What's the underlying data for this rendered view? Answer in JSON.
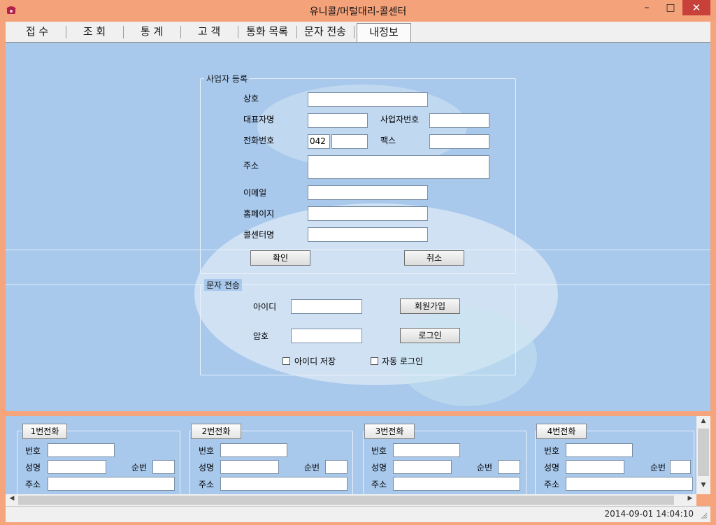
{
  "window": {
    "title": "유니콜/머털대리-콜센터",
    "minimize": "–",
    "maximize": "□",
    "close": "✕"
  },
  "tabs": [
    {
      "label": "접 수"
    },
    {
      "label": "조 회"
    },
    {
      "label": "통 계"
    },
    {
      "label": "고 객"
    },
    {
      "label": "통화 목록"
    },
    {
      "label": "문자 전송"
    },
    {
      "label": "내정보"
    }
  ],
  "business_reg": {
    "legend": "사업자 등록",
    "company_label": "상호",
    "company_value": "",
    "rep_label": "대표자명",
    "rep_value": "",
    "bizno_label": "사업자번호",
    "bizno_value": "",
    "phone_label": "전화번호",
    "phone_area": "042",
    "phone_value": "",
    "fax_label": "팩스",
    "fax_value": "",
    "address_label": "주소",
    "address_value": "",
    "email_label": "이메일",
    "email_value": "",
    "homepage_label": "홈페이지",
    "homepage_value": "",
    "callcenter_label": "콜센터명",
    "callcenter_value": "",
    "confirm_button": "확인",
    "cancel_button": "취소"
  },
  "sms": {
    "legend": "문자 전송",
    "id_label": "아이디",
    "id_value": "",
    "join_button": "회원가입",
    "pw_label": "암호",
    "pw_value": "",
    "login_button": "로그인",
    "save_id_label": "아이디 저장",
    "save_id_checked": false,
    "auto_login_label": "자동 로그인",
    "auto_login_checked": false
  },
  "lines": [
    {
      "tab": "1번전화",
      "no_label": "번호",
      "name_label": "성명",
      "seq_label": "순번",
      "addr_label": "주소",
      "no": "",
      "name": "",
      "seq": "",
      "addr": ""
    },
    {
      "tab": "2번전화",
      "no_label": "번호",
      "name_label": "성명",
      "seq_label": "순번",
      "addr_label": "주소",
      "no": "",
      "name": "",
      "seq": "",
      "addr": ""
    },
    {
      "tab": "3번전화",
      "no_label": "번호",
      "name_label": "성명",
      "seq_label": "순번",
      "addr_label": "주소",
      "no": "",
      "name": "",
      "seq": "",
      "addr": ""
    },
    {
      "tab": "4번전화",
      "no_label": "번호",
      "name_label": "성명",
      "seq_label": "순번",
      "addr_label": "주소",
      "no": "",
      "name": "",
      "seq": "",
      "addr": ""
    }
  ],
  "scrollbar": {
    "up": "▲",
    "down": "▼",
    "left": "◀",
    "right": "▶"
  },
  "status": {
    "datetime": "2014-09-01 14:04:10"
  },
  "colors": {
    "titlebar": "#f4a27a",
    "background": "#a8c8ec",
    "close": "#c7403a"
  }
}
